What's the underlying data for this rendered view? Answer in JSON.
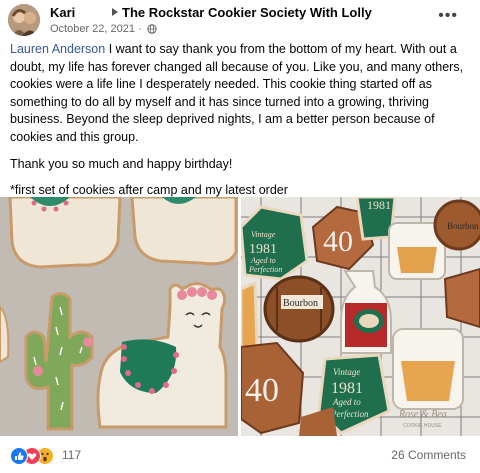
{
  "post": {
    "author": "Kari",
    "group": "The Rockstar Cookier Society With Lolly",
    "date": "October 22, 2021",
    "privacy_icon": "globe-icon",
    "more_icon": "more-options-icon"
  },
  "content": {
    "mention": "Lauren Anderson",
    "paragraph1": " I want to say thank you from the bottom of my heart. With out a doubt, my life has forever changed all because of you. Like you, and many others, cookies were a life line I desperately needed. This cookie thing started off as something to do all by myself and it has since turned into a growing, thriving business. Beyond the sleep deprived nights, I am a better person because of cookies and this group.",
    "paragraph2": "Thank you so much and happy birthday!",
    "paragraph3": "*first set of cookies after camp and my latest order"
  },
  "photos": {
    "right": {
      "plaque_lines": [
        "Vintage",
        "1981",
        "Aged to",
        "Perfection"
      ],
      "big_number": "40",
      "barrel_label": "Bourbon",
      "watermark": "Rose & Bea",
      "watermark_sub": "COOKIE HOUSE"
    }
  },
  "footer": {
    "reactions": [
      "like-reaction-icon",
      "love-reaction-icon",
      "wow-reaction-icon"
    ],
    "reaction_count": "117",
    "comments": "26 Comments"
  },
  "colors": {
    "mention": "#385898",
    "like": "#1877f2",
    "love": "#f33e58",
    "wow": "#f7b125"
  }
}
